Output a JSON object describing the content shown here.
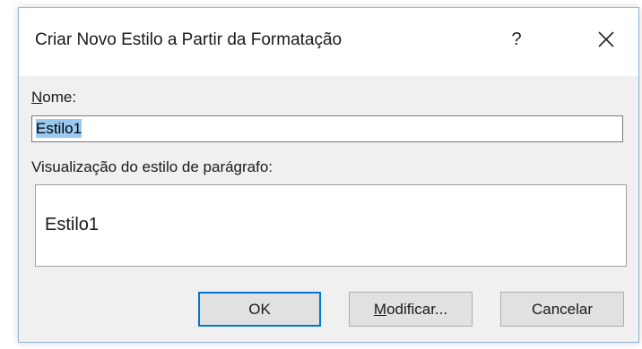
{
  "dialog": {
    "title": "Criar Novo Estilo a Partir da Formatação",
    "help_label": "?",
    "close_icon": "close-icon"
  },
  "name_field": {
    "label_access_key": "N",
    "label_rest": "ome:",
    "value": "Estilo1"
  },
  "preview": {
    "label": "Visualização do estilo de parágrafo:",
    "sample_text": "Estilo1"
  },
  "buttons": {
    "ok": "OK",
    "modify_access_key": "M",
    "modify_rest": "odificar...",
    "cancel": "Cancelar"
  },
  "colors": {
    "dialog_bg": "#f0f0f0",
    "selection": "#99c9ef",
    "default_button_border": "#0078d7"
  }
}
